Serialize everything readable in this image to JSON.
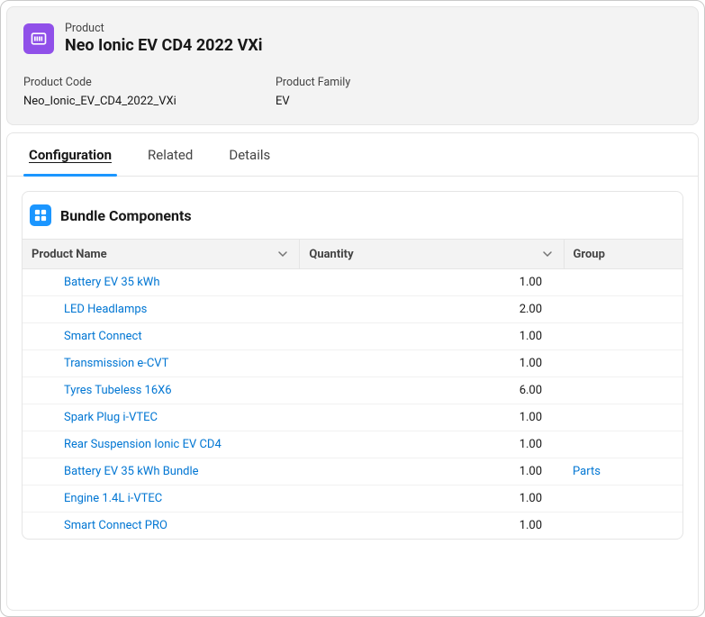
{
  "header": {
    "overline": "Product",
    "title": "Neo Ionic EV CD4 2022 VXi",
    "fields": [
      {
        "label": "Product Code",
        "value": "Neo_Ionic_EV_CD4_2022_VXi"
      },
      {
        "label": "Product Family",
        "value": "EV"
      }
    ]
  },
  "tabs": [
    {
      "label": "Configuration",
      "active": true
    },
    {
      "label": "Related",
      "active": false
    },
    {
      "label": "Details",
      "active": false
    }
  ],
  "panel": {
    "title": "Bundle Components",
    "columns": [
      {
        "label": "Product Name"
      },
      {
        "label": "Quantity"
      },
      {
        "label": "Group"
      }
    ],
    "rows": [
      {
        "name": "Battery EV 35 kWh",
        "qty": "1.00",
        "group": ""
      },
      {
        "name": "LED Headlamps",
        "qty": "2.00",
        "group": ""
      },
      {
        "name": "Smart Connect",
        "qty": "1.00",
        "group": ""
      },
      {
        "name": "Transmission e-CVT",
        "qty": "1.00",
        "group": ""
      },
      {
        "name": "Tyres Tubeless 16X6",
        "qty": "6.00",
        "group": ""
      },
      {
        "name": "Spark Plug i-VTEC",
        "qty": "1.00",
        "group": ""
      },
      {
        "name": "Rear Suspension Ionic EV CD4",
        "qty": "1.00",
        "group": ""
      },
      {
        "name": "Battery EV 35 kWh Bundle",
        "qty": "1.00",
        "group": "Parts"
      },
      {
        "name": "Engine 1.4L i-VTEC",
        "qty": "1.00",
        "group": ""
      },
      {
        "name": "Smart Connect PRO",
        "qty": "1.00",
        "group": ""
      }
    ]
  }
}
